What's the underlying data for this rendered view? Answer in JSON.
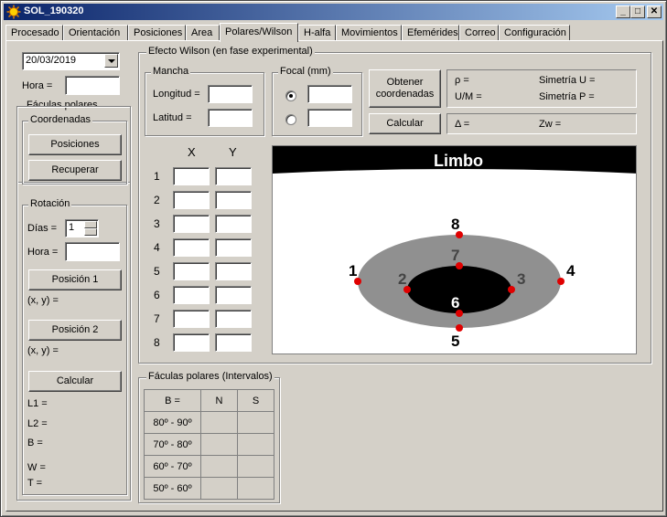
{
  "window": {
    "title": "SOL_190320",
    "minimize": "_",
    "maximize": "□",
    "close": "✕"
  },
  "tabs": [
    "Procesado",
    "Orientación",
    "Posiciones",
    "Area",
    "Polares/Wilson",
    "H-alfa",
    "Movimientos",
    "Efemérides",
    "Correo",
    "Configuración"
  ],
  "left": {
    "date_value": "20/03/2019",
    "hora_label": "Hora =",
    "faculas_group": "Fáculas polares",
    "coordenadas_group": "Coordenadas",
    "posiciones_btn": "Posiciones",
    "recuperar_btn": "Recuperar",
    "rotacion_group": "Rotación",
    "dias_label": "Días =",
    "dias_value": "1",
    "hora2_label": "Hora =",
    "pos1_btn": "Posición 1",
    "xy1": "(x, y) =",
    "pos2_btn": "Posición 2",
    "xy2": "(x, y) =",
    "calcular_btn": "Calcular",
    "results": [
      "L1 =",
      "L2 =",
      "B =",
      "W =",
      "T ="
    ]
  },
  "wilson": {
    "group": "Efecto Wilson (en fase experimental)",
    "mancha_group": "Mancha",
    "longitud_label": "Longitud =",
    "latitud_label": "Latitud =",
    "focal_group": "Focal (mm)",
    "obtener_btn": [
      "Obtener",
      "coordenadas"
    ],
    "calcular_btn": "Calcular",
    "rho": "ρ =",
    "simetria_u": "Simetría U =",
    "um": "U/M =",
    "simetria_p": "Simetría P =",
    "delta": "Δ =",
    "zw": "Zw =",
    "col_x": "X",
    "col_y": "Y",
    "rows": [
      "1",
      "2",
      "3",
      "4",
      "5",
      "6",
      "7",
      "8"
    ],
    "limbo_title": "Limbo",
    "points": [
      "1",
      "2",
      "3",
      "4",
      "5",
      "6",
      "7",
      "8"
    ],
    "colors": {
      "point": "#e00000",
      "penumbra": "#909090",
      "umbra": "#000000"
    }
  },
  "faculas_int": {
    "group": "Fáculas polares (Intervalos)",
    "header": [
      "B =",
      "N",
      "S"
    ],
    "rows": [
      "80º - 90º",
      "70º - 80º",
      "60º - 70º",
      "50º - 60º"
    ]
  }
}
